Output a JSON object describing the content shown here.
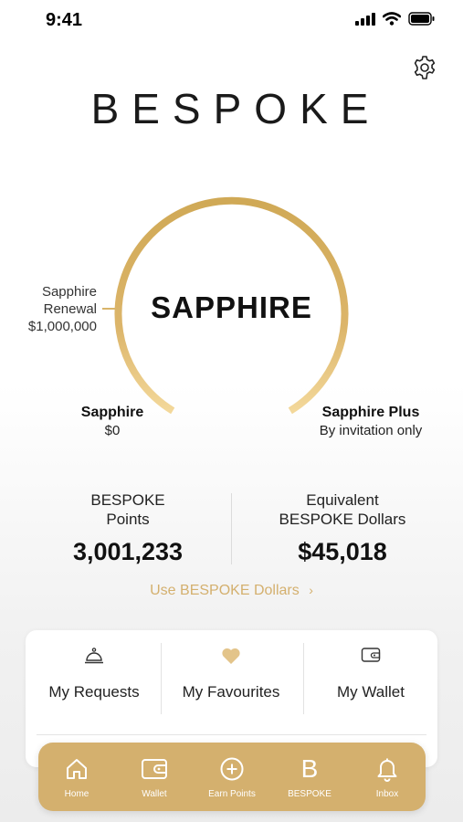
{
  "status_bar": {
    "time": "9:41",
    "icons": [
      "signal-icon",
      "wifi-icon",
      "battery-icon"
    ]
  },
  "header": {
    "brand": "BESPOKE",
    "settings_icon": "gear-icon"
  },
  "tier": {
    "current": "SAPPHIRE",
    "renewal_line1": "Sapphire",
    "renewal_line2": "Renewal",
    "renewal_amount": "$1,000,000",
    "left_name": "Sapphire",
    "left_value": "$0",
    "right_name": "Sapphire Plus",
    "right_value": "By invitation only",
    "progress": 0.5
  },
  "stats": {
    "points_label_1": "BESPOKE",
    "points_label_2": "Points",
    "points_value": "3,001,233",
    "dollars_label_1": "Equivalent",
    "dollars_label_2": "BESPOKE Dollars",
    "dollars_value": "$45,018",
    "use_link": "Use BESPOKE Dollars",
    "use_link_chevron": "›"
  },
  "quick_actions": [
    {
      "label": "My Requests",
      "icon": "service-bell-icon"
    },
    {
      "label": "My Favourites",
      "icon": "heart-icon"
    },
    {
      "label": "My Wallet",
      "icon": "wallet-icon"
    }
  ],
  "tabs": [
    {
      "label": "Home",
      "icon": "home-icon"
    },
    {
      "label": "Wallet",
      "icon": "wallet-icon"
    },
    {
      "label": "Earn Points",
      "icon": "plus-circle-icon"
    },
    {
      "label": "BESPOKE",
      "icon": "b-letter-icon",
      "glyph": "B"
    },
    {
      "label": "Inbox",
      "icon": "bell-icon"
    }
  ],
  "colors": {
    "gold": "#d4b06e",
    "gold_dark": "#c9a24f",
    "gold_light": "#f0d596"
  }
}
